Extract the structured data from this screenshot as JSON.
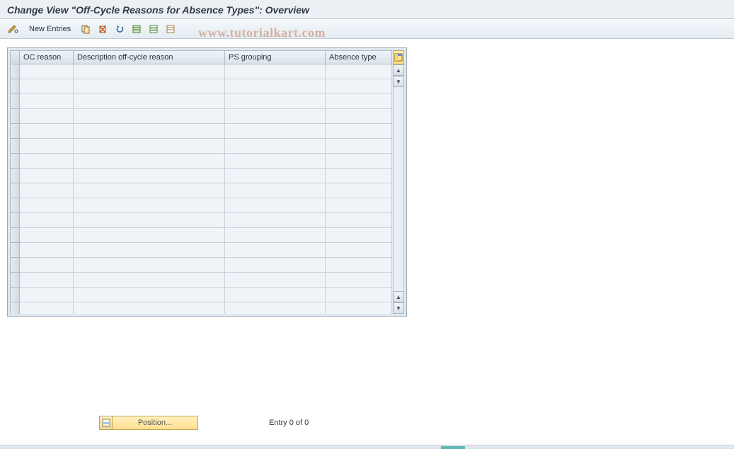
{
  "title": "Change View \"Off-Cycle Reasons for Absence Types\": Overview",
  "toolbar": {
    "new_entries_label": "New Entries"
  },
  "watermark": "www.tutorialkart.com",
  "table": {
    "columns": {
      "oc_reason": "OC reason",
      "description": "Description off-cycle reason",
      "ps_grouping": "PS grouping",
      "absence_type": "Absence type"
    },
    "rows": []
  },
  "footer": {
    "position_label": "Position...",
    "entry_status": "Entry 0 of 0"
  }
}
